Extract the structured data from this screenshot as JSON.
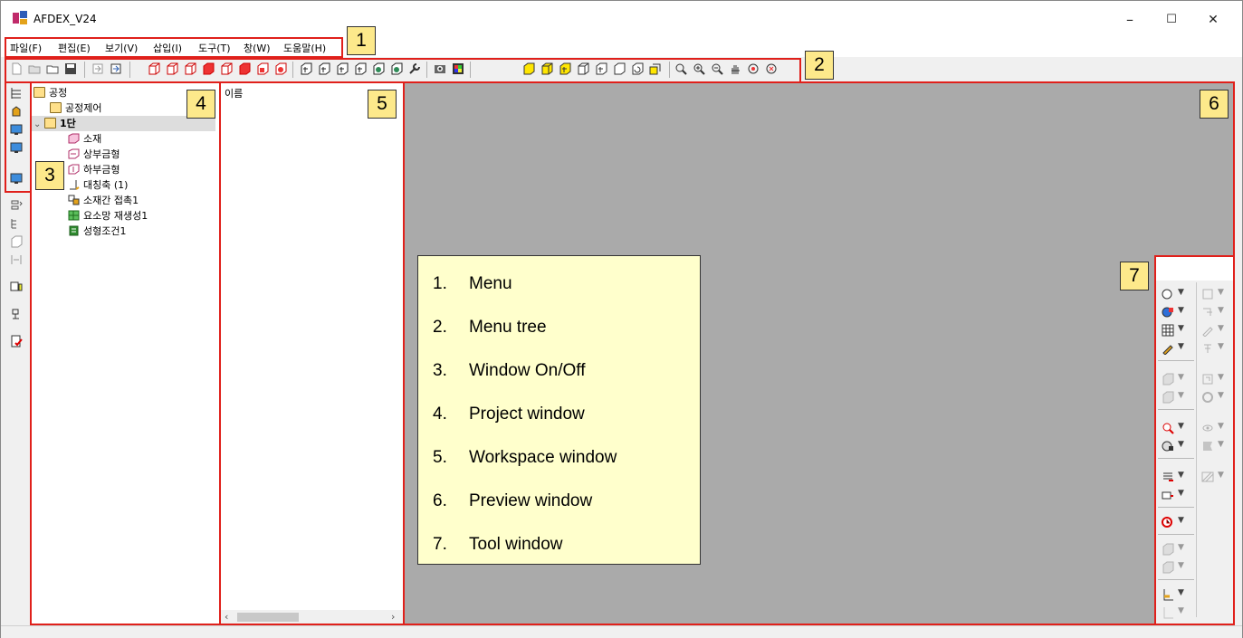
{
  "window": {
    "title": "AFDEX_V24",
    "controls": {
      "minimize": "–",
      "maximize": "☐",
      "close": "✕"
    }
  },
  "menu": [
    {
      "label": "파일(F)"
    },
    {
      "label": "편집(E)"
    },
    {
      "label": "보기(V)"
    },
    {
      "label": "삽입(I)"
    },
    {
      "label": "도구(T)"
    },
    {
      "label": "창(W)"
    },
    {
      "label": "도움말(H)"
    }
  ],
  "project_tree": {
    "root": "공정",
    "items": [
      {
        "label": "공정제어",
        "icon": "folder-icon"
      },
      {
        "label": "1단",
        "icon": "folder-open-icon",
        "expanded": true,
        "selected": true
      },
      {
        "label": "소재",
        "icon": "material-icon"
      },
      {
        "label": "상부금형",
        "icon": "upper-die-icon"
      },
      {
        "label": "하부금형",
        "icon": "lower-die-icon"
      },
      {
        "label": "대칭축 (1)",
        "icon": "symmetry-axis-icon"
      },
      {
        "label": "소재간 접촉1",
        "icon": "contact-icon"
      },
      {
        "label": "요소망 재생성1",
        "icon": "remesh-icon"
      },
      {
        "label": "성형조건1",
        "icon": "forming-condition-icon"
      }
    ]
  },
  "workspace": {
    "header": "이름"
  },
  "badges": [
    "1",
    "2",
    "3",
    "4",
    "5",
    "6",
    "7"
  ],
  "legend": [
    {
      "num": "1.",
      "text": "Menu"
    },
    {
      "num": "2.",
      "text": "Menu tree"
    },
    {
      "num": "3.",
      "text": "Window On/Off"
    },
    {
      "num": "4.",
      "text": "Project window"
    },
    {
      "num": "5.",
      "text": "Workspace window"
    },
    {
      "num": "6.",
      "text": "Preview window"
    },
    {
      "num": "7.",
      "text": "Tool window"
    }
  ],
  "colors": {
    "annotation_red": "#e0201b",
    "badge_yellow": "#fde98b",
    "legend_bg": "#ffffcc",
    "preview_bg": "#aaaaaa"
  }
}
